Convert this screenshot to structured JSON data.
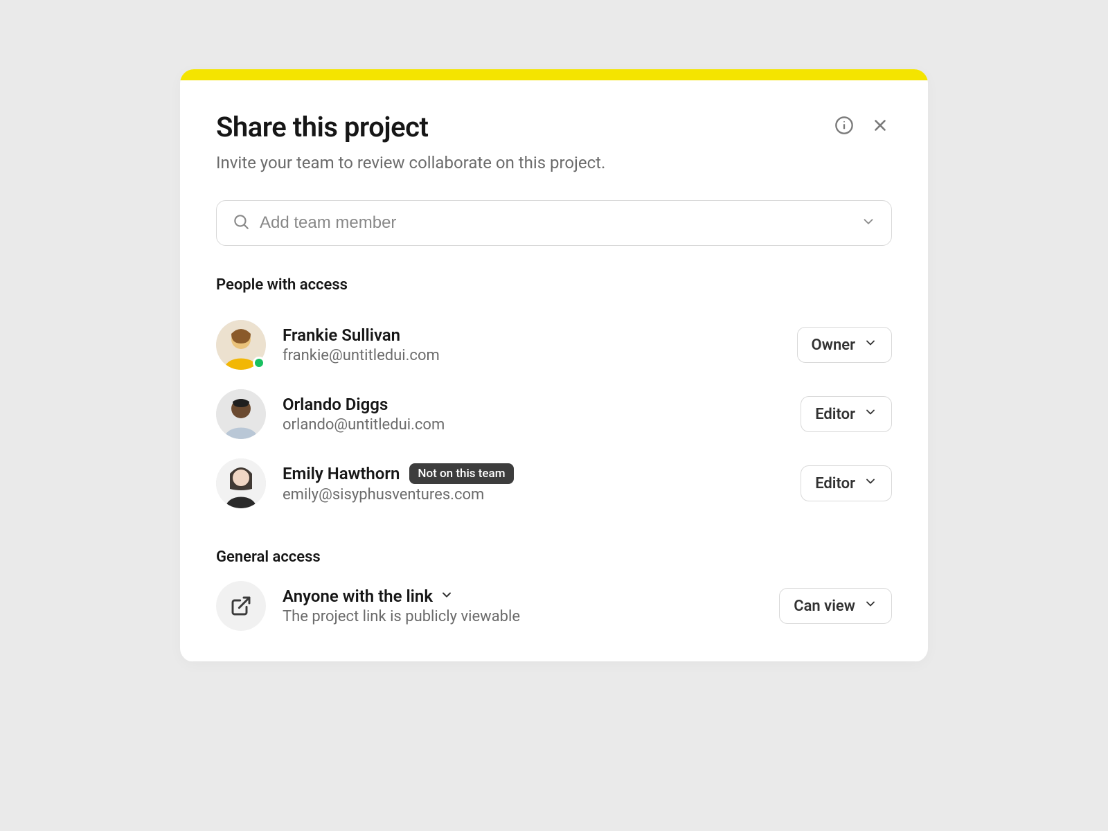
{
  "header": {
    "title": "Share this project",
    "subtitle": "Invite your team to review collaborate on this project."
  },
  "search": {
    "placeholder": "Add team member"
  },
  "sections": {
    "people_label": "People with access",
    "general_label": "General access"
  },
  "people": [
    {
      "name": "Frankie Sullivan",
      "email": "frankie@untitledui.com",
      "role": "Owner",
      "online": true,
      "badge": null,
      "avatar_bg": "#e9c27a",
      "avatar_shirt": "#f2b705"
    },
    {
      "name": "Orlando Diggs",
      "email": "orlando@untitledui.com",
      "role": "Editor",
      "online": false,
      "badge": null,
      "avatar_bg": "#6b4a30",
      "avatar_shirt": "#b9c7d6"
    },
    {
      "name": "Emily Hawthorn",
      "email": "emily@sisyphusventures.com",
      "role": "Editor",
      "online": false,
      "badge": "Not on this team",
      "avatar_bg": "#f0d6c4",
      "avatar_shirt": "#2a2a2a"
    }
  ],
  "general": {
    "scope": "Anyone with the link",
    "description": "The project link is publicly viewable",
    "permission": "Can view"
  }
}
